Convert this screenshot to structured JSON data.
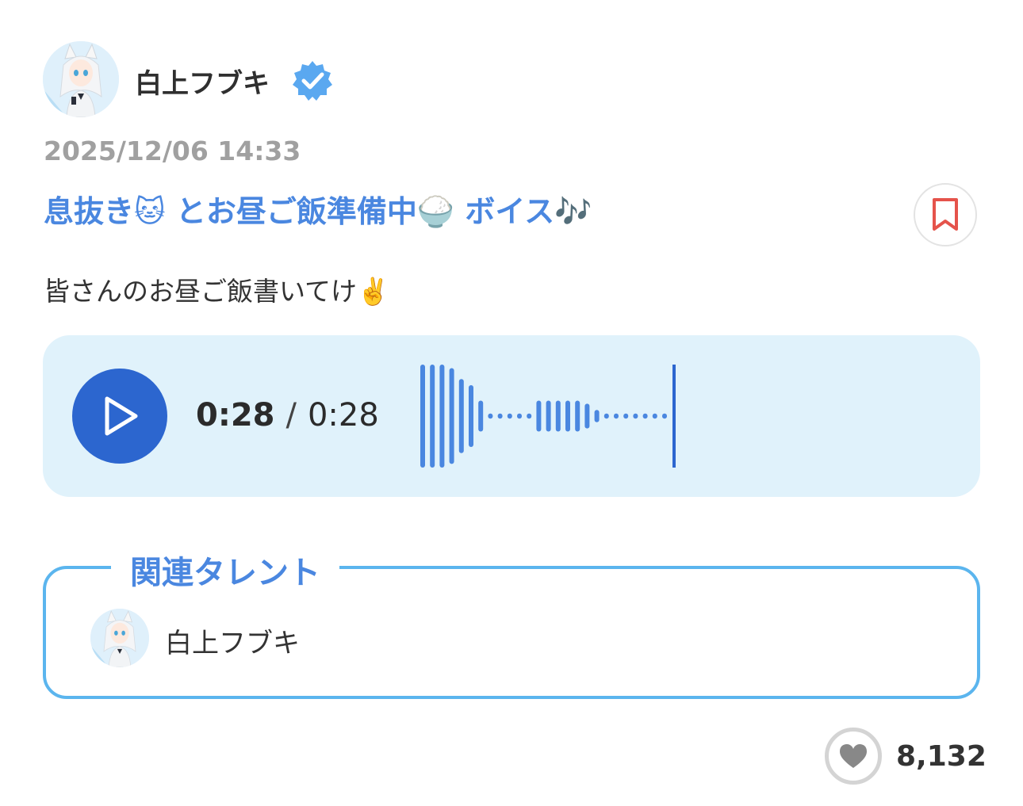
{
  "post": {
    "author": {
      "name": "白上フブキ",
      "avatar_icon": "character-avatar-icon",
      "verified_icon": "verified-badge-icon",
      "verified_color": "#5aa8f0"
    },
    "date": "2025/12/06 14:33",
    "title": "息抜き🐱 とお昼ご飯準備中🍚 ボイス🎶",
    "body": "皆さんのお昼ご飯書いてけ✌️",
    "bookmark_icon": "bookmark-icon",
    "bookmark_color": "#e5534b"
  },
  "player": {
    "play_icon": "play-icon",
    "current_time": "0:28",
    "separator": "/",
    "duration": "0:28",
    "progress": 1.0,
    "accent_color": "#2c66cf",
    "wave_color": "#4a87e0",
    "waveform_levels": [
      1.0,
      1.0,
      1.0,
      0.93,
      0.72,
      0.6,
      0.3,
      0.05,
      0.05,
      0.05,
      0.05,
      0.05,
      0.3,
      0.3,
      0.3,
      0.3,
      0.3,
      0.24,
      0.12,
      0.05,
      0.05,
      0.05,
      0.05,
      0.05,
      0.05,
      0.05
    ]
  },
  "related": {
    "heading": "関連タレント",
    "talents": [
      {
        "name": "白上フブキ",
        "avatar_icon": "character-avatar-icon"
      }
    ],
    "border_color": "#5bb5ee"
  },
  "like": {
    "icon": "heart-icon",
    "count": "8,132"
  }
}
